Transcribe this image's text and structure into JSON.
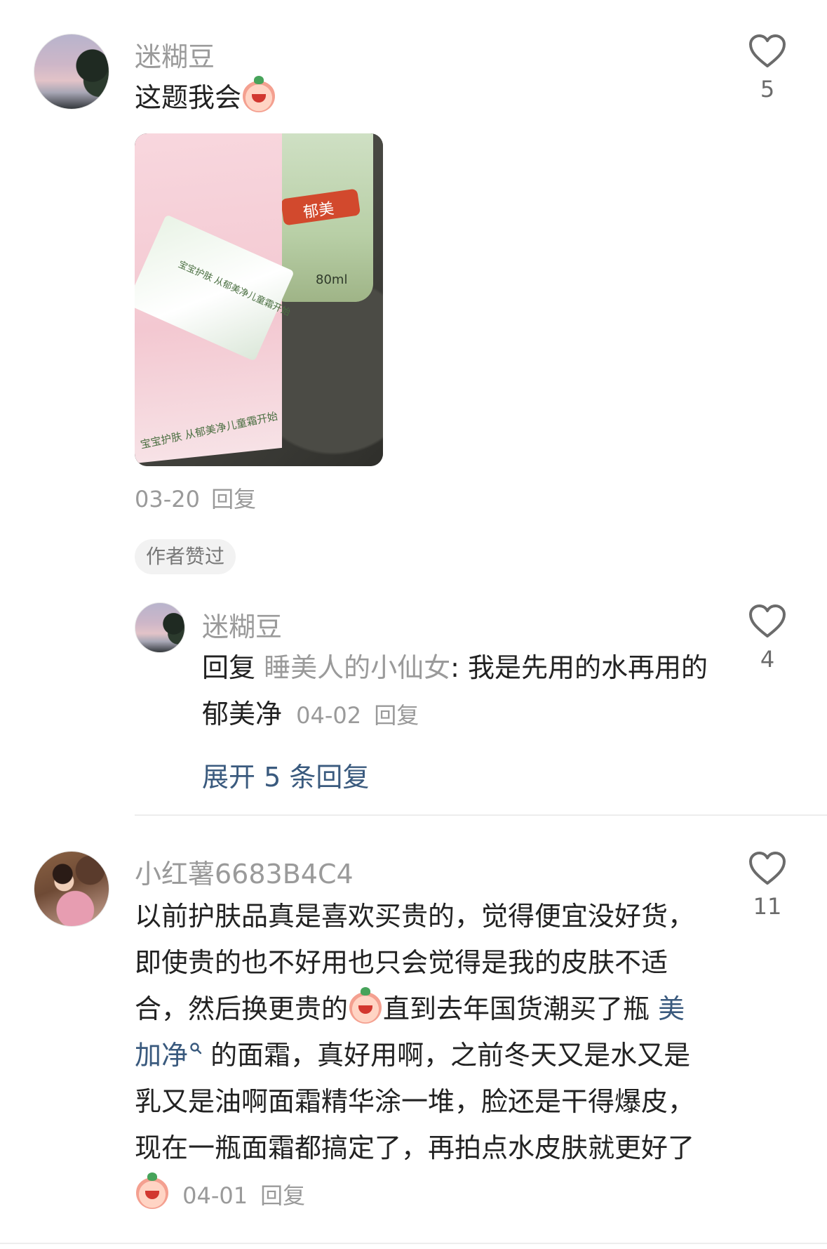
{
  "comments": [
    {
      "username": "迷糊豆",
      "text": "这题我会",
      "emoji": "smirk-face-emoji",
      "photo_texts": {
        "bottle_volume": "80ml",
        "bottle_label": "郁美",
        "box_tagline": "宝宝护肤  从郁美净儿童霜开始",
        "sachet_tagline": "宝宝护肤  从郁美净儿童霜开始"
      },
      "date": "03-20",
      "reply_label": "回复",
      "likes": "5",
      "badge": "作者赞过"
    },
    {
      "username": "小红薯6683B4C4",
      "text_parts": [
        "以前护肤品真是喜欢买贵的，觉得便宜没好货，即使贵的也不好用也只会觉得是我的皮肤不适合，然后换更贵的",
        "直到去年国货潮买了瓶 ",
        " 的面霜，真好用啊，之前冬天又是水又是乳又是油啊面霜精华涂一堆，脸还是干得爆皮，现在一瓶面霜都搞定了，再拍点水皮肤就更好了"
      ],
      "hashtag": "美加净",
      "date": "04-01",
      "reply_label": "回复",
      "likes": "11"
    }
  ],
  "reply": {
    "username": "迷糊豆",
    "prefix": "回复",
    "target": "睡美人的小仙女",
    "colon": ":",
    "text": " 我是先用的水再用的郁美净",
    "date": "04-02",
    "reply_label": "回复",
    "likes": "4"
  },
  "expand_label": "展开 5 条回复",
  "colors": {
    "username": "#9a9a9a",
    "link": "#3a5a7e",
    "text": "#222222"
  }
}
